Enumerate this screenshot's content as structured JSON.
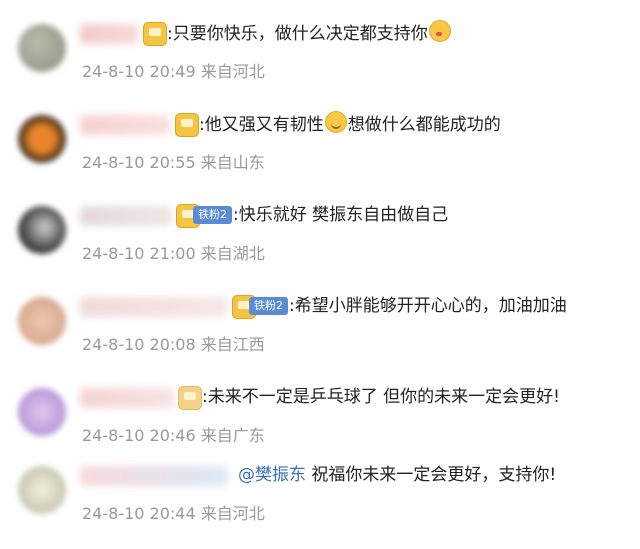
{
  "comments": [
    {
      "text": ":只要你快乐，做什么决定都支持你",
      "meta": "24-8-10 20:49 来自河北",
      "avatar_color": "#8a8f80"
    },
    {
      "text": ":他又强又有韧性",
      "text2": "想做什么都能成功的",
      "meta": "24-8-10 20:55 来自山东",
      "avatar_color": "#e07a20"
    },
    {
      "badge": "铁粉2",
      "text": ":快乐就好 樊振东自由做自己",
      "meta": "24-8-10 21:00 来自湖北",
      "avatar_color": "#5a5a5a"
    },
    {
      "badge": "铁粉2",
      "text": ":希望小胖能够开开心心的，加油加油",
      "meta": "24-8-10 20:08 来自江西",
      "avatar_color": "#e8b8a0"
    },
    {
      "text": ":未来不一定是乒乓球了 但你的未来一定会更好!",
      "meta": "24-8-10 20:46 来自广东",
      "avatar_color": "#c8a8e8"
    },
    {
      "mention": "@樊振东",
      "text": "祝福你未来一定会更好，支持你!",
      "meta": "24-8-10 20:44 来自河北",
      "avatar_color": "#d8d8c8"
    }
  ]
}
